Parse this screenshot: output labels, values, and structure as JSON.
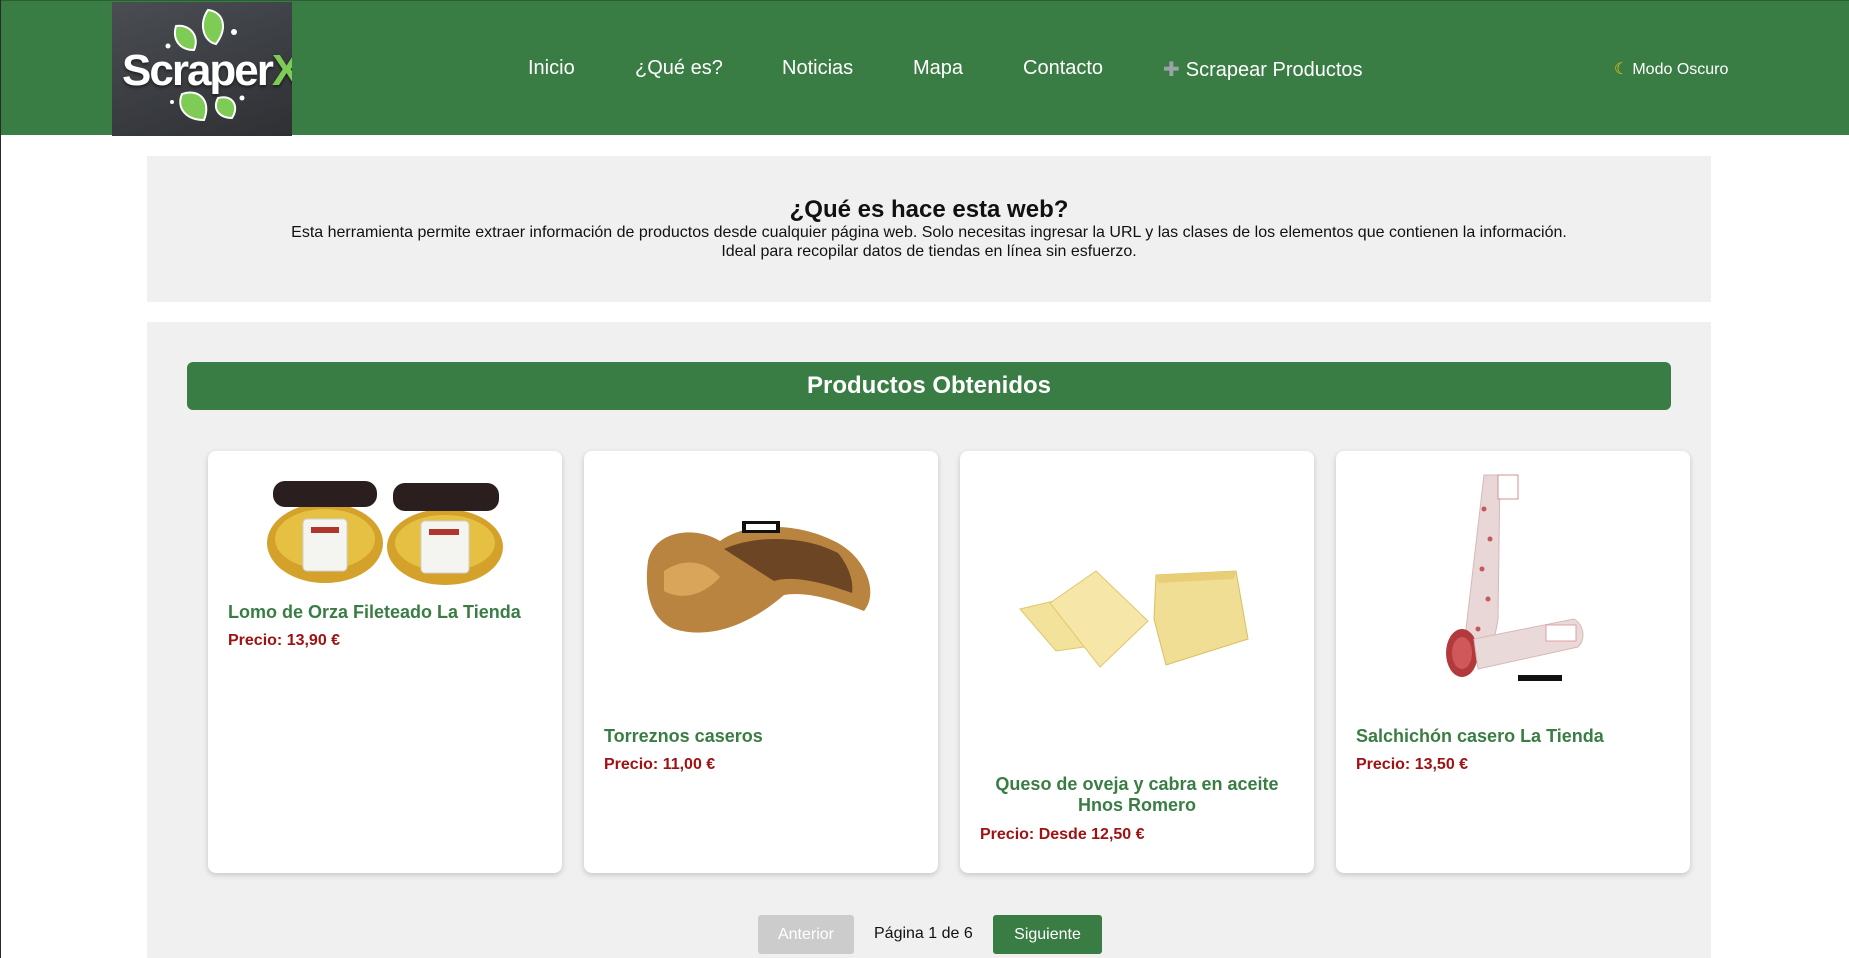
{
  "brand": {
    "logo_text": "Scraper",
    "logo_x": "X"
  },
  "nav": {
    "items": [
      {
        "label": "Inicio"
      },
      {
        "label": "¿Qué es?"
      },
      {
        "label": "Noticias"
      },
      {
        "label": "Mapa"
      },
      {
        "label": "Contacto"
      },
      {
        "label": "Scrapear Productos",
        "icon": "plus-icon"
      }
    ],
    "dark_mode_label": "Modo Oscuro",
    "dark_mode_icon": "moon-icon"
  },
  "intro": {
    "title": "¿Qué es hace esta web?",
    "line1": "Esta herramienta permite extraer información de productos desde cualquier página web. Solo necesitas ingresar la URL y las clases de los elementos que contienen la información.",
    "line2": "Ideal para recopilar datos de tiendas en línea sin esfuerzo."
  },
  "products": {
    "title": "Productos Obtenidos",
    "items": [
      {
        "name": "Lomo de Orza Fileteado La Tienda",
        "price": "Precio: 13,90 €",
        "image": "jars-of-lomo-image"
      },
      {
        "name": "Torreznos caseros",
        "price": "Precio: 11,00 €",
        "image": "torreznos-image"
      },
      {
        "name": "Queso de oveja y cabra en aceite Hnos Romero",
        "price": "Precio: Desde 12,50 €",
        "image": "cheese-wedges-image"
      },
      {
        "name": "Salchichón casero La Tienda",
        "price": "Precio: 13,50 €",
        "image": "salchichon-image"
      }
    ]
  },
  "pagination": {
    "prev_label": "Anterior",
    "page_info": "Página 1 de 6",
    "next_label": "Siguiente"
  },
  "colors": {
    "primary_green": "#3a7d44",
    "price_red": "#a01212",
    "section_bg": "#f0f0f0"
  }
}
